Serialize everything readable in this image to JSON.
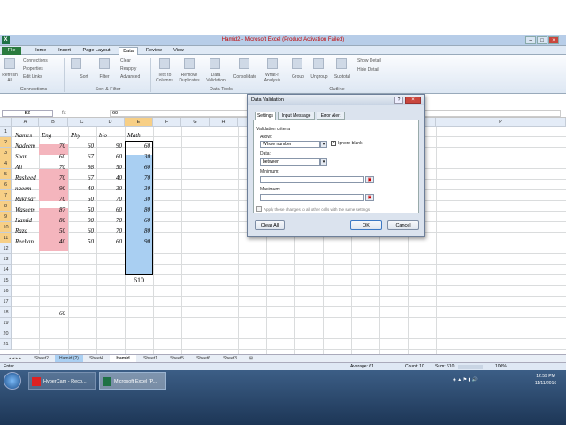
{
  "window": {
    "title": "Hamid2 - Microsoft Excel (Product Activation Failed)",
    "app_icon": "X"
  },
  "ribbon_tabs": [
    "File",
    "Home",
    "Insert",
    "Page Layout",
    "Data",
    "Review",
    "View"
  ],
  "ribbon": {
    "refresh": "Refresh All",
    "connections": "Connections",
    "properties": "Properties",
    "edit_links": "Edit Links",
    "group_connections": "Connections",
    "sort": "Sort",
    "filter": "Filter",
    "clear": "Clear",
    "reapply": "Reapply",
    "advanced": "Advanced",
    "group_sort": "Sort & Filter",
    "text_to_columns": "Text to Columns",
    "remove_duplicates": "Remove Duplicates",
    "data_validation": "Data Validation",
    "consolidate": "Consolidate",
    "what_if": "What-If Analysis",
    "group_tools": "Data Tools",
    "group_btn": "Group",
    "ungroup": "Ungroup",
    "subtotal": "Subtotal",
    "show_detail": "Show Detail",
    "hide_detail": "Hide Detail",
    "group_outline": "Outline"
  },
  "formula_bar": {
    "name_box": "E2",
    "value": "60"
  },
  "columns": [
    "A",
    "B",
    "C",
    "D",
    "E",
    "F",
    "G",
    "H",
    "I",
    "J",
    "K",
    "L",
    "M",
    "N",
    "O",
    "P"
  ],
  "rows": [
    "1",
    "2",
    "3",
    "4",
    "5",
    "6",
    "7",
    "8",
    "9",
    "10",
    "11",
    "12",
    "13",
    "14",
    "15",
    "16",
    "17",
    "18",
    "19",
    "20",
    "21"
  ],
  "headers": [
    "Names",
    "Eng",
    "Phy",
    "bio",
    "Math"
  ],
  "table": [
    [
      "Nadeem",
      "70",
      "60",
      "90",
      "60"
    ],
    [
      "Shan",
      "60",
      "67",
      "60",
      "30"
    ],
    [
      "Ali",
      "70",
      "98",
      "50",
      "60"
    ],
    [
      "Rasheed",
      "70",
      "67",
      "40",
      "70"
    ],
    [
      "naeem",
      "90",
      "40",
      "30",
      "30"
    ],
    [
      "Rukhsar",
      "70",
      "50",
      "70",
      "30"
    ],
    [
      "Waseem",
      "87",
      "50",
      "60",
      "80"
    ],
    [
      "Hamid",
      "80",
      "90",
      "70",
      "60"
    ],
    [
      "Raza",
      "50",
      "60",
      "70",
      "80"
    ],
    [
      "Reehan",
      "40",
      "50",
      "60",
      "90"
    ]
  ],
  "total_cell": "610",
  "b14_value": "60",
  "sheet_tabs": [
    "Sheet2",
    "Hamid (2)",
    "Sheet4",
    "Hamid",
    "Sheet1",
    "Sheet5",
    "Sheet6",
    "Sheet3"
  ],
  "status": {
    "mode": "Enter",
    "average": "Average: 61",
    "count": "Count: 10",
    "sum": "Sum: 610",
    "zoom": "100%"
  },
  "dialog": {
    "title": "Data Validation",
    "tabs": [
      "Settings",
      "Input Message",
      "Error Alert"
    ],
    "section": "Validation criteria",
    "allow_label": "Allow:",
    "allow_value": "Whole number",
    "ignore_blank": "Ignore blank",
    "data_label": "Data:",
    "data_value": "between",
    "min_label": "Minimum:",
    "max_label": "Maximum:",
    "apply_all": "Apply these changes to all other cells with the same settings",
    "clear_all": "Clear All",
    "ok": "OK",
    "cancel": "Cancel"
  },
  "taskbar": {
    "hypercam": "HyperCam - Reco...",
    "excel": "Microsoft Excel (P...",
    "time": "12:59 PM",
    "date": "11/11/2016"
  },
  "colors": {
    "pink": "#f4b5bd",
    "blue": "#a9cff2",
    "title_text": "#c00000"
  }
}
